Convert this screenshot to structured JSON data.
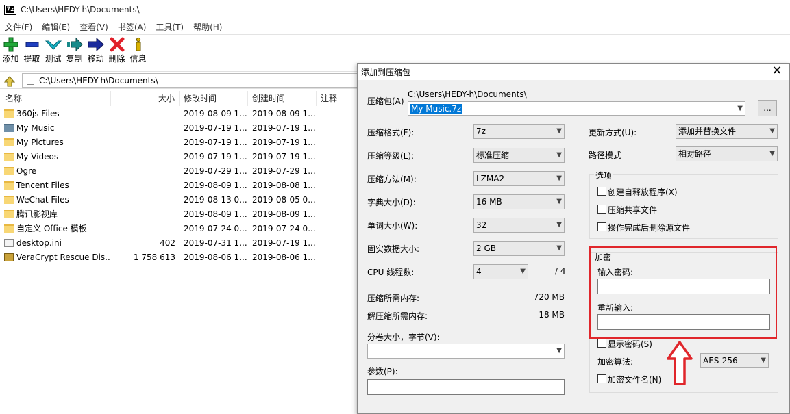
{
  "window": {
    "app_icon_text": "7z",
    "title": "C:\\Users\\HEDY-h\\Documents\\"
  },
  "menu": [
    "文件(F)",
    "编辑(E)",
    "查看(V)",
    "书签(A)",
    "工具(T)",
    "帮助(H)"
  ],
  "toolbar": [
    {
      "label": "添加",
      "icon": "plus-icon",
      "color": "#22a83a"
    },
    {
      "label": "提取",
      "icon": "minus-icon",
      "color": "#1f3fbf"
    },
    {
      "label": "测试",
      "icon": "check-icon",
      "color": "#18b5c8"
    },
    {
      "label": "复制",
      "icon": "copy-arrow-icon",
      "color": "#178a8a"
    },
    {
      "label": "移动",
      "icon": "move-arrow-icon",
      "color": "#1c2b9c"
    },
    {
      "label": "删除",
      "icon": "delete-x-icon",
      "color": "#e0202a"
    },
    {
      "label": "信息",
      "icon": "info-icon",
      "color": "#d9b200"
    }
  ],
  "address": "C:\\Users\\HEDY-h\\Documents\\",
  "columns": {
    "name": "名称",
    "size": "大小",
    "modified": "修改时间",
    "created": "创建时间",
    "comment": "注释"
  },
  "files": [
    {
      "name": "360js Files",
      "size": "",
      "modified": "2019-08-09 1...",
      "created": "2019-08-09 1...",
      "icon": "folder"
    },
    {
      "name": "My Music",
      "size": "",
      "modified": "2019-07-19 1...",
      "created": "2019-07-19 1...",
      "icon": "music"
    },
    {
      "name": "My Pictures",
      "size": "",
      "modified": "2019-07-19 1...",
      "created": "2019-07-19 1...",
      "icon": "folder"
    },
    {
      "name": "My Videos",
      "size": "",
      "modified": "2019-07-19 1...",
      "created": "2019-07-19 1...",
      "icon": "folder"
    },
    {
      "name": "Ogre",
      "size": "",
      "modified": "2019-07-29 1...",
      "created": "2019-07-29 1...",
      "icon": "folder"
    },
    {
      "name": "Tencent Files",
      "size": "",
      "modified": "2019-08-09 1...",
      "created": "2019-08-08 1...",
      "icon": "folder"
    },
    {
      "name": "WeChat Files",
      "size": "",
      "modified": "2019-08-13 0...",
      "created": "2019-08-05 0...",
      "icon": "folder"
    },
    {
      "name": "腾讯影视库",
      "size": "",
      "modified": "2019-08-09 1...",
      "created": "2019-08-09 1...",
      "icon": "folder"
    },
    {
      "name": "自定义 Office 模板",
      "size": "",
      "modified": "2019-07-24 0...",
      "created": "2019-07-24 0...",
      "icon": "folder"
    },
    {
      "name": "desktop.ini",
      "size": "402",
      "modified": "2019-07-31 1...",
      "created": "2019-07-19 1...",
      "icon": "ini"
    },
    {
      "name": "VeraCrypt Rescue Dis...",
      "size": "1 758 613",
      "modified": "2019-08-06 1...",
      "created": "2019-08-06 1...",
      "icon": "iso"
    }
  ],
  "dialog": {
    "title": "添加到压缩包",
    "archive_label": "压缩包(A)",
    "archive_path": "C:\\Users\\HEDY-h\\Documents\\",
    "archive_name": "My Music.7z",
    "browse_button": "...",
    "format_label": "压缩格式(F):",
    "format_value": "7z",
    "level_label": "压缩等级(L):",
    "level_value": "标准压缩",
    "method_label": "压缩方法(M):",
    "method_value": "LZMA2",
    "dict_label": "字典大小(D):",
    "dict_value": "16 MB",
    "word_label": "单词大小(W):",
    "word_value": "32",
    "solid_label": "固实数据大小:",
    "solid_value": "2 GB",
    "cpu_label": "CPU 线程数:",
    "cpu_value": "4",
    "cpu_max": "/ 4",
    "mem_compress_label": "压缩所需内存:",
    "mem_compress_value": "720 MB",
    "mem_decompress_label": "解压缩所需内存:",
    "mem_decompress_value": "18 MB",
    "volume_label": "分卷大小，字节(V):",
    "params_label": "参数(P):",
    "update_label": "更新方式(U):",
    "update_value": "添加并替换文件",
    "path_label": "路径模式",
    "path_value": "相对路径",
    "options_title": "选项",
    "opt_sfx": "创建自释放程序(X)",
    "opt_shared": "压缩共享文件",
    "opt_delete": "操作完成后删除源文件",
    "enc_title": "加密",
    "enc_password_label": "输入密码:",
    "enc_reenter_label": "重新输入:",
    "show_password": "显示密码(S)",
    "enc_method_label": "加密算法:",
    "enc_method_value": "AES-256",
    "encrypt_names": "加密文件名(N)"
  },
  "highlight_color": "#e0262b"
}
